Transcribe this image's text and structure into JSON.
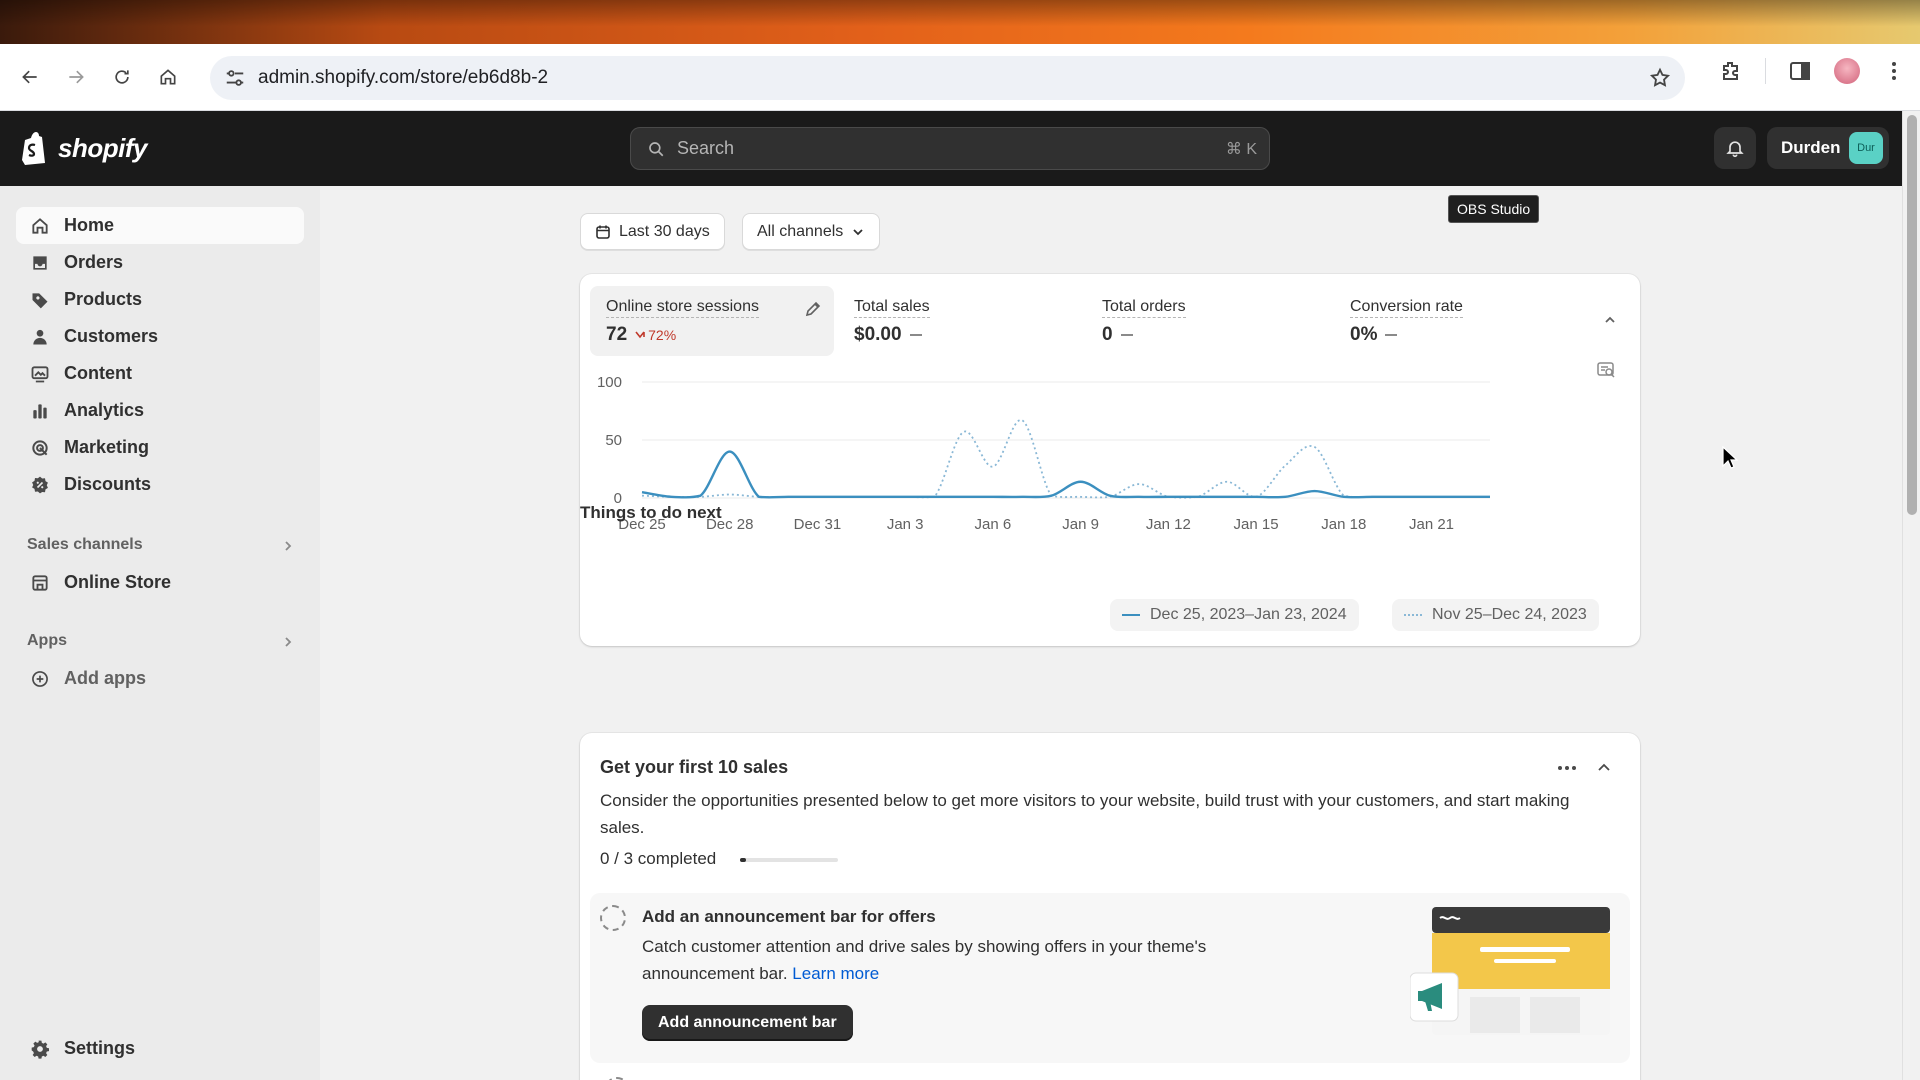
{
  "browser": {
    "url": "admin.shopify.com/store/eb6d8b-2"
  },
  "topbar": {
    "brand": "shopify",
    "search_placeholder": "Search",
    "search_shortcut": "⌘ K",
    "user_name": "Durden",
    "user_initials": "Dur",
    "tooltip": "OBS Studio"
  },
  "sidebar": {
    "items": [
      {
        "label": "Home",
        "icon": "home-icon"
      },
      {
        "label": "Orders",
        "icon": "inbox-icon"
      },
      {
        "label": "Products",
        "icon": "tag-icon"
      },
      {
        "label": "Customers",
        "icon": "person-icon"
      },
      {
        "label": "Content",
        "icon": "image-icon"
      },
      {
        "label": "Analytics",
        "icon": "bar-chart-icon"
      },
      {
        "label": "Marketing",
        "icon": "target-icon"
      },
      {
        "label": "Discounts",
        "icon": "discount-icon"
      }
    ],
    "sales_channels_label": "Sales channels",
    "online_store": "Online Store",
    "apps_label": "Apps",
    "add_apps": "Add apps",
    "settings": "Settings"
  },
  "filters": {
    "date_range": "Last 30 days",
    "channels": "All channels"
  },
  "metrics": [
    {
      "label": "Online store sessions",
      "value": "72",
      "change": "72%"
    },
    {
      "label": "Total sales",
      "value": "$0.00"
    },
    {
      "label": "Total orders",
      "value": "0"
    },
    {
      "label": "Conversion rate",
      "value": "0%"
    }
  ],
  "chart_data": {
    "type": "line",
    "x_ticks": [
      "Dec 25",
      "Dec 28",
      "Dec 31",
      "Jan 3",
      "Jan 6",
      "Jan 9",
      "Jan 12",
      "Jan 15",
      "Jan 18",
      "Jan 21"
    ],
    "y_ticks": [
      "100",
      "50",
      "0"
    ],
    "ylim": [
      0,
      100
    ],
    "xlim": [
      0,
      29
    ],
    "grid": true,
    "legend_placement": "bottom-right",
    "series": [
      {
        "name": "Dec 25, 2023–Jan 23, 2024",
        "style": "solid",
        "color": "#3b8fbf",
        "points": [
          [
            0,
            5
          ],
          [
            1,
            1
          ],
          [
            2,
            2
          ],
          [
            3,
            40
          ],
          [
            4,
            1
          ],
          [
            5,
            1
          ],
          [
            6,
            1
          ],
          [
            7,
            1
          ],
          [
            8,
            1
          ],
          [
            9,
            1
          ],
          [
            10,
            1
          ],
          [
            11,
            1
          ],
          [
            12,
            1
          ],
          [
            13,
            1
          ],
          [
            14,
            2
          ],
          [
            15,
            14
          ],
          [
            16,
            2
          ],
          [
            17,
            1
          ],
          [
            18,
            1
          ],
          [
            19,
            1
          ],
          [
            20,
            1
          ],
          [
            21,
            1
          ],
          [
            22,
            1
          ],
          [
            23,
            6
          ],
          [
            24,
            1
          ],
          [
            25,
            1
          ],
          [
            26,
            1
          ],
          [
            27,
            1
          ],
          [
            28,
            1
          ],
          [
            29,
            1
          ]
        ]
      },
      {
        "name": "Nov 25–Dec 24, 2023",
        "style": "dotted",
        "color": "#8ab8d6",
        "points": [
          [
            0,
            2
          ],
          [
            1,
            1
          ],
          [
            2,
            1
          ],
          [
            3,
            3
          ],
          [
            4,
            1
          ],
          [
            5,
            1
          ],
          [
            6,
            1
          ],
          [
            7,
            1
          ],
          [
            8,
            1
          ],
          [
            9,
            1
          ],
          [
            10,
            1
          ],
          [
            11,
            57
          ],
          [
            12,
            27
          ],
          [
            13,
            67
          ],
          [
            14,
            2
          ],
          [
            15,
            1
          ],
          [
            16,
            1
          ],
          [
            17,
            12
          ],
          [
            18,
            1
          ],
          [
            19,
            1
          ],
          [
            20,
            14
          ],
          [
            21,
            1
          ],
          [
            22,
            28
          ],
          [
            23,
            44
          ],
          [
            24,
            2
          ],
          [
            25,
            1
          ],
          [
            26,
            1
          ],
          [
            27,
            1
          ],
          [
            28,
            1
          ],
          [
            29,
            1
          ]
        ]
      }
    ]
  },
  "things_to_do": {
    "section_title": "Things to do next",
    "card_title": "Get your first 10 sales",
    "card_desc": "Consider the opportunities presented below to get more visitors to your website, build trust with your customers, and start making sales.",
    "progress_text": "0 / 3 completed",
    "progress_fraction": 0,
    "task": {
      "title": "Add an announcement bar for offers",
      "desc": "Catch customer attention and drive sales by showing offers in your theme's announcement bar.",
      "link": "Learn more",
      "button": "Add announcement bar"
    }
  }
}
